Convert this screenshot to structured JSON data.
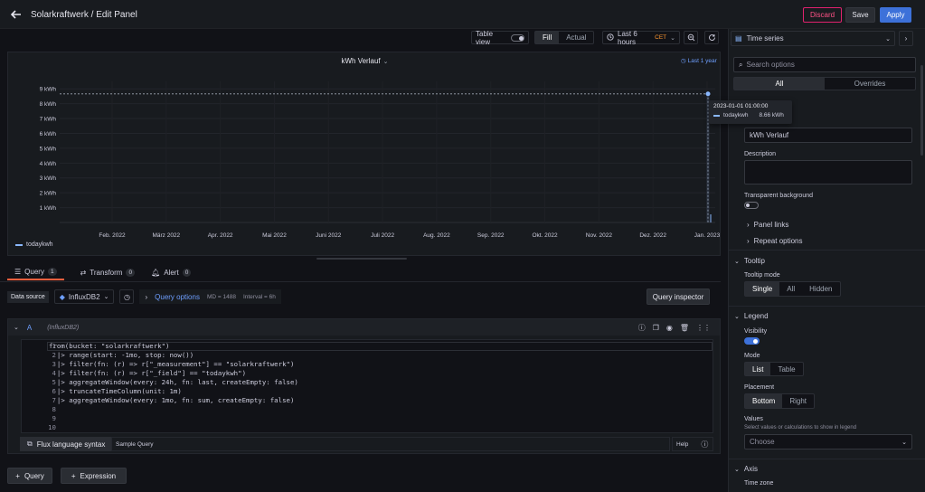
{
  "header": {
    "title": "Solarkraftwerk / Edit Panel",
    "discard": "Discard",
    "save": "Save",
    "apply": "Apply"
  },
  "toolbar": {
    "table_view": "Table view",
    "fill": "Fill",
    "actual": "Actual",
    "time_range": "Last 6 hours",
    "timezone": "CET"
  },
  "panel": {
    "title": "kWh Verlauf",
    "relative_time": "Last 1 year"
  },
  "chart_data": {
    "type": "line",
    "title": "kWh Verlauf",
    "y_ticks": [
      "1 kWh",
      "2 kWh",
      "3 kWh",
      "4 kWh",
      "5 kWh",
      "6 kWh",
      "7 kWh",
      "8 kWh",
      "9 kWh"
    ],
    "x_ticks": [
      "Feb. 2022",
      "März 2022",
      "Apr. 2022",
      "Mai 2022",
      "Juni 2022",
      "Juli 2022",
      "Aug. 2022",
      "Sep. 2022",
      "Okt. 2022",
      "Nov. 2022",
      "Dez. 2022",
      "Jan. 2023"
    ],
    "ylim": [
      0,
      9.5
    ],
    "series": [
      {
        "name": "todaykwh",
        "points": [
          {
            "x": "2023-01-01 01:00:00",
            "y": 8.66
          }
        ]
      }
    ],
    "legend": "bottom-left",
    "grid": true,
    "tooltip": {
      "time": "2023-01-01 01:00:00",
      "series": "todaykwh",
      "value": "8.66 kWh"
    }
  },
  "query_tabs": [
    {
      "label": "Query",
      "count": "1"
    },
    {
      "label": "Transform",
      "count": "0"
    },
    {
      "label": "Alert",
      "count": "0"
    }
  ],
  "datasource": {
    "label": "Data source",
    "name": "InfluxDB2",
    "query_options": "Query options",
    "md": "MD = 1488",
    "interval": "Interval = 6h",
    "inspector": "Query inspector"
  },
  "query": {
    "ref": "A",
    "source": "(InfluxDB2)",
    "line_numbers": [
      "1",
      "2",
      "3",
      "4",
      "5",
      "6",
      "7",
      "8",
      "9",
      "10"
    ],
    "lines": [
      "from(bucket: \"solarkraftwerk\")",
      "  |> range(start: -1mo, stop: now())",
      "  |> filter(fn: (r) => r[\"_measurement\"] == \"solarkraftwerk\")",
      "  |> filter(fn: (r) => r[\"_field\"] == \"todaykwh\")",
      "  |> aggregateWindow(every: 24h, fn: last, createEmpty: false)",
      "  |> truncateTimeColumn(unit: 1m)",
      "  |> aggregateWindow(every: 1mo, fn: sum, createEmpty: false)",
      "",
      "",
      ""
    ],
    "flux_syntax": "Flux language syntax",
    "sample_query": "Sample Query",
    "help": "Help"
  },
  "bottom_buttons": {
    "query": "Query",
    "expression": "Expression"
  },
  "options": {
    "viz": "Time series",
    "search_placeholder": "Search options",
    "tab_all": "All",
    "tab_overrides": "Overrides",
    "title_value": "kWh Verlauf",
    "description": "Description",
    "transparent": "Transparent background",
    "panel_links": "Panel links",
    "repeat_options": "Repeat options",
    "tooltip_section": "Tooltip",
    "tooltip_mode": "Tooltip mode",
    "tooltip_modes": [
      "Single",
      "All",
      "Hidden"
    ],
    "legend_section": "Legend",
    "visibility": "Visibility",
    "mode": "Mode",
    "modes": [
      "List",
      "Table"
    ],
    "placement": "Placement",
    "placements": [
      "Bottom",
      "Right"
    ],
    "values": "Values",
    "values_hint": "Select values or calculations to show in legend",
    "values_placeholder": "Choose",
    "axis_section": "Axis",
    "time_zone": "Time zone"
  },
  "colors": {
    "accent": "#3d71d9",
    "series": "#8ab8ff",
    "discard": "#e0226e",
    "bg": "#111217",
    "panel": "#181b1f"
  }
}
